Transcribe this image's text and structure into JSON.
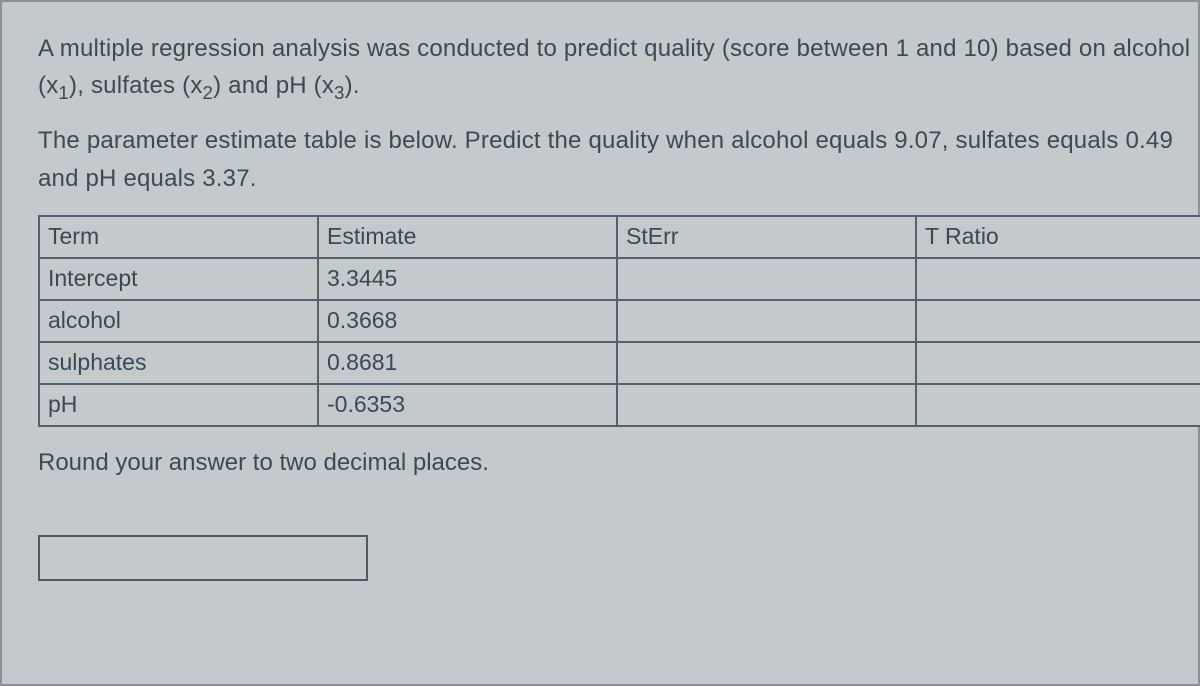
{
  "question": {
    "p1_a": "A multiple regression analysis was conducted to predict quality (score between 1 and 10) based on alcohol (x",
    "p1_s1": "1",
    "p1_b": "), sulfates (x",
    "p1_s2": "2",
    "p1_c": ") and pH (x",
    "p1_s3": "3",
    "p1_d": ").",
    "p2": "The parameter estimate table is below. Predict the quality when alcohol equals 9.07, sulfates equals 0.49 and pH equals 3.37.",
    "instruction": "Round your answer to two decimal places."
  },
  "table": {
    "headers": {
      "term": "Term",
      "estimate": "Estimate",
      "sterr": "StErr",
      "tratio": "T Ratio"
    },
    "rows": [
      {
        "term": "Intercept",
        "estimate": "3.3445",
        "sterr": "",
        "tratio": ""
      },
      {
        "term": "alcohol",
        "estimate": "0.3668",
        "sterr": "",
        "tratio": ""
      },
      {
        "term": "sulphates",
        "estimate": "0.8681",
        "sterr": "",
        "tratio": ""
      },
      {
        "term": "pH",
        "estimate": "-0.6353",
        "sterr": "",
        "tratio": ""
      }
    ]
  },
  "answer": {
    "value": ""
  }
}
